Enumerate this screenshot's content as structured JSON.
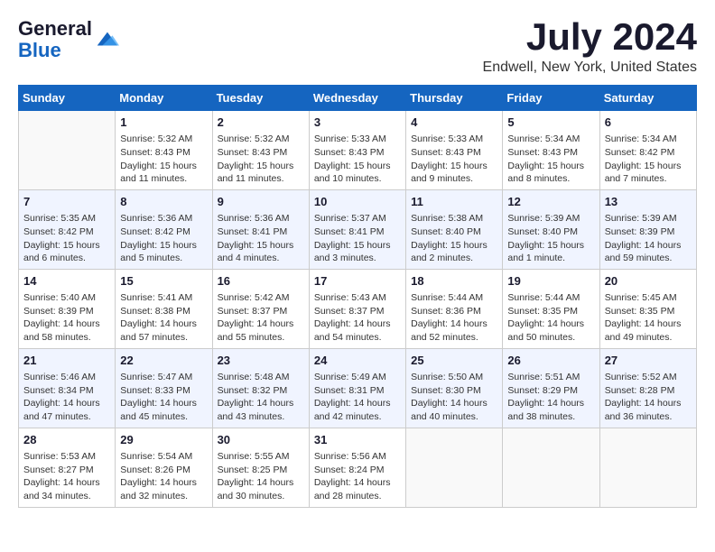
{
  "header": {
    "logo_line1": "General",
    "logo_line2": "Blue",
    "month_year": "July 2024",
    "location": "Endwell, New York, United States"
  },
  "days_of_week": [
    "Sunday",
    "Monday",
    "Tuesday",
    "Wednesday",
    "Thursday",
    "Friday",
    "Saturday"
  ],
  "weeks": [
    [
      {
        "day": "",
        "info": ""
      },
      {
        "day": "1",
        "info": "Sunrise: 5:32 AM\nSunset: 8:43 PM\nDaylight: 15 hours\nand 11 minutes."
      },
      {
        "day": "2",
        "info": "Sunrise: 5:32 AM\nSunset: 8:43 PM\nDaylight: 15 hours\nand 11 minutes."
      },
      {
        "day": "3",
        "info": "Sunrise: 5:33 AM\nSunset: 8:43 PM\nDaylight: 15 hours\nand 10 minutes."
      },
      {
        "day": "4",
        "info": "Sunrise: 5:33 AM\nSunset: 8:43 PM\nDaylight: 15 hours\nand 9 minutes."
      },
      {
        "day": "5",
        "info": "Sunrise: 5:34 AM\nSunset: 8:43 PM\nDaylight: 15 hours\nand 8 minutes."
      },
      {
        "day": "6",
        "info": "Sunrise: 5:34 AM\nSunset: 8:42 PM\nDaylight: 15 hours\nand 7 minutes."
      }
    ],
    [
      {
        "day": "7",
        "info": "Sunrise: 5:35 AM\nSunset: 8:42 PM\nDaylight: 15 hours\nand 6 minutes."
      },
      {
        "day": "8",
        "info": "Sunrise: 5:36 AM\nSunset: 8:42 PM\nDaylight: 15 hours\nand 5 minutes."
      },
      {
        "day": "9",
        "info": "Sunrise: 5:36 AM\nSunset: 8:41 PM\nDaylight: 15 hours\nand 4 minutes."
      },
      {
        "day": "10",
        "info": "Sunrise: 5:37 AM\nSunset: 8:41 PM\nDaylight: 15 hours\nand 3 minutes."
      },
      {
        "day": "11",
        "info": "Sunrise: 5:38 AM\nSunset: 8:40 PM\nDaylight: 15 hours\nand 2 minutes."
      },
      {
        "day": "12",
        "info": "Sunrise: 5:39 AM\nSunset: 8:40 PM\nDaylight: 15 hours\nand 1 minute."
      },
      {
        "day": "13",
        "info": "Sunrise: 5:39 AM\nSunset: 8:39 PM\nDaylight: 14 hours\nand 59 minutes."
      }
    ],
    [
      {
        "day": "14",
        "info": "Sunrise: 5:40 AM\nSunset: 8:39 PM\nDaylight: 14 hours\nand 58 minutes."
      },
      {
        "day": "15",
        "info": "Sunrise: 5:41 AM\nSunset: 8:38 PM\nDaylight: 14 hours\nand 57 minutes."
      },
      {
        "day": "16",
        "info": "Sunrise: 5:42 AM\nSunset: 8:37 PM\nDaylight: 14 hours\nand 55 minutes."
      },
      {
        "day": "17",
        "info": "Sunrise: 5:43 AM\nSunset: 8:37 PM\nDaylight: 14 hours\nand 54 minutes."
      },
      {
        "day": "18",
        "info": "Sunrise: 5:44 AM\nSunset: 8:36 PM\nDaylight: 14 hours\nand 52 minutes."
      },
      {
        "day": "19",
        "info": "Sunrise: 5:44 AM\nSunset: 8:35 PM\nDaylight: 14 hours\nand 50 minutes."
      },
      {
        "day": "20",
        "info": "Sunrise: 5:45 AM\nSunset: 8:35 PM\nDaylight: 14 hours\nand 49 minutes."
      }
    ],
    [
      {
        "day": "21",
        "info": "Sunrise: 5:46 AM\nSunset: 8:34 PM\nDaylight: 14 hours\nand 47 minutes."
      },
      {
        "day": "22",
        "info": "Sunrise: 5:47 AM\nSunset: 8:33 PM\nDaylight: 14 hours\nand 45 minutes."
      },
      {
        "day": "23",
        "info": "Sunrise: 5:48 AM\nSunset: 8:32 PM\nDaylight: 14 hours\nand 43 minutes."
      },
      {
        "day": "24",
        "info": "Sunrise: 5:49 AM\nSunset: 8:31 PM\nDaylight: 14 hours\nand 42 minutes."
      },
      {
        "day": "25",
        "info": "Sunrise: 5:50 AM\nSunset: 8:30 PM\nDaylight: 14 hours\nand 40 minutes."
      },
      {
        "day": "26",
        "info": "Sunrise: 5:51 AM\nSunset: 8:29 PM\nDaylight: 14 hours\nand 38 minutes."
      },
      {
        "day": "27",
        "info": "Sunrise: 5:52 AM\nSunset: 8:28 PM\nDaylight: 14 hours\nand 36 minutes."
      }
    ],
    [
      {
        "day": "28",
        "info": "Sunrise: 5:53 AM\nSunset: 8:27 PM\nDaylight: 14 hours\nand 34 minutes."
      },
      {
        "day": "29",
        "info": "Sunrise: 5:54 AM\nSunset: 8:26 PM\nDaylight: 14 hours\nand 32 minutes."
      },
      {
        "day": "30",
        "info": "Sunrise: 5:55 AM\nSunset: 8:25 PM\nDaylight: 14 hours\nand 30 minutes."
      },
      {
        "day": "31",
        "info": "Sunrise: 5:56 AM\nSunset: 8:24 PM\nDaylight: 14 hours\nand 28 minutes."
      },
      {
        "day": "",
        "info": ""
      },
      {
        "day": "",
        "info": ""
      },
      {
        "day": "",
        "info": ""
      }
    ]
  ]
}
